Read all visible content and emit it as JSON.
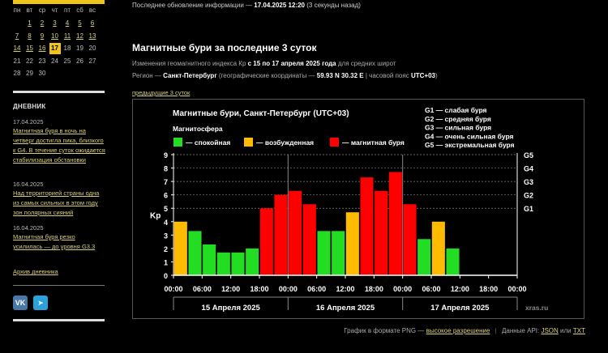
{
  "calendar": {
    "weekdays": [
      "пн",
      "вт",
      "ср",
      "чт",
      "пт",
      "сб",
      "вс"
    ],
    "rows": [
      [
        "",
        "1",
        "2",
        "3",
        "4",
        "5",
        "6"
      ],
      [
        "7",
        "8",
        "9",
        "10",
        "11",
        "12",
        "13"
      ],
      [
        "14",
        "15",
        "16",
        "17",
        "18",
        "19",
        "20"
      ],
      [
        "21",
        "22",
        "23",
        "24",
        "25",
        "26",
        "27"
      ],
      [
        "28",
        "29",
        "30",
        "",
        "",
        "",
        ""
      ]
    ],
    "today": "17",
    "last_linked_day": 17
  },
  "diary": {
    "title": "ДНЕВНИК",
    "entries": [
      {
        "date": "17.04.2025",
        "text": "Магнитная буря в ночь на четверг достигла пика, близкого к G4. В течение суток ожидается стабилизация обстановки"
      },
      {
        "date": "16.04.2025",
        "text": "Над территорией страны одна из самых сильных в этом году зон полярных сияний"
      },
      {
        "date": "16.04.2025",
        "text": "Магнитная буря резко усилилась — до уровня G3.3"
      }
    ],
    "archive_label": "Архив дневника"
  },
  "social": {
    "vk": "VK",
    "telegram": "➤"
  },
  "update": {
    "prefix": "Последнее обновление информации —",
    "time": "17.04.2025 12:20",
    "ago": "(3 секунды назад)"
  },
  "page": {
    "title": "Магнитные бури за последние 3 суток",
    "desc_prefix": "Изменения геомагнитного индекса Кр",
    "desc_period": "с 15 по 17 апреля 2025 года",
    "desc_suffix": "для средних широт",
    "region_label": "Регион —",
    "region_name": "Санкт-Петербург",
    "coords_prefix": "(географические координаты —",
    "coords": "59.93 N 30.32 E",
    "tz_prefix": "| часовой пояс",
    "tz": "UTC+03",
    "tz_suffix": ")",
    "prev_link": "предыдущие 3 суток"
  },
  "chart_data": {
    "type": "bar",
    "title": "Магнитные бури, Санкт-Петербург (UTC+03)",
    "subtitle": "Магнитосфера",
    "ylabel": "Kp",
    "ylim": [
      0,
      9
    ],
    "yticks": [
      "0",
      "1",
      "2",
      "3",
      "4",
      "5",
      "6",
      "7",
      "8",
      "9"
    ],
    "g_levels": [
      {
        "label": "G1",
        "kp": 5
      },
      {
        "label": "G2",
        "kp": 6
      },
      {
        "label": "G3",
        "kp": 7
      },
      {
        "label": "G4",
        "kp": 8
      },
      {
        "label": "G5",
        "kp": 9
      }
    ],
    "g_legend": [
      "G1 — слабая буря",
      "G2 — средняя буря",
      "G3 — сильная буря",
      "G4 — очень сильная буря",
      "G5 — экстремальная буря"
    ],
    "legend": [
      {
        "label": "— спокойная",
        "color": "#22dd22"
      },
      {
        "label": "— возбужденная",
        "color": "#ffbb00"
      },
      {
        "label": "— магнитная буря",
        "color": "#ff0000"
      }
    ],
    "xticks": [
      "00:00",
      "06:00",
      "12:00",
      "18:00",
      "00:00",
      "06:00",
      "12:00",
      "18:00",
      "00:00",
      "06:00",
      "12:00",
      "18:00",
      "00:00"
    ],
    "days": [
      "15 Апреля 2025",
      "16 Апреля 2025",
      "17 Апреля 2025"
    ],
    "values": [
      4.0,
      3.3,
      2.3,
      1.7,
      1.7,
      2.0,
      5.0,
      6.0,
      6.3,
      5.3,
      3.3,
      3.3,
      4.7,
      7.3,
      6.3,
      7.7,
      5.3,
      2.7,
      4.0,
      2.0
    ],
    "watermark": "xras.ru"
  },
  "footer": {
    "png_prefix": "График в формате PNG —",
    "png_link": "высокое разрешение",
    "api_prefix": "Данные API:",
    "json": "JSON",
    "or": "или",
    "txt": "TXT"
  }
}
